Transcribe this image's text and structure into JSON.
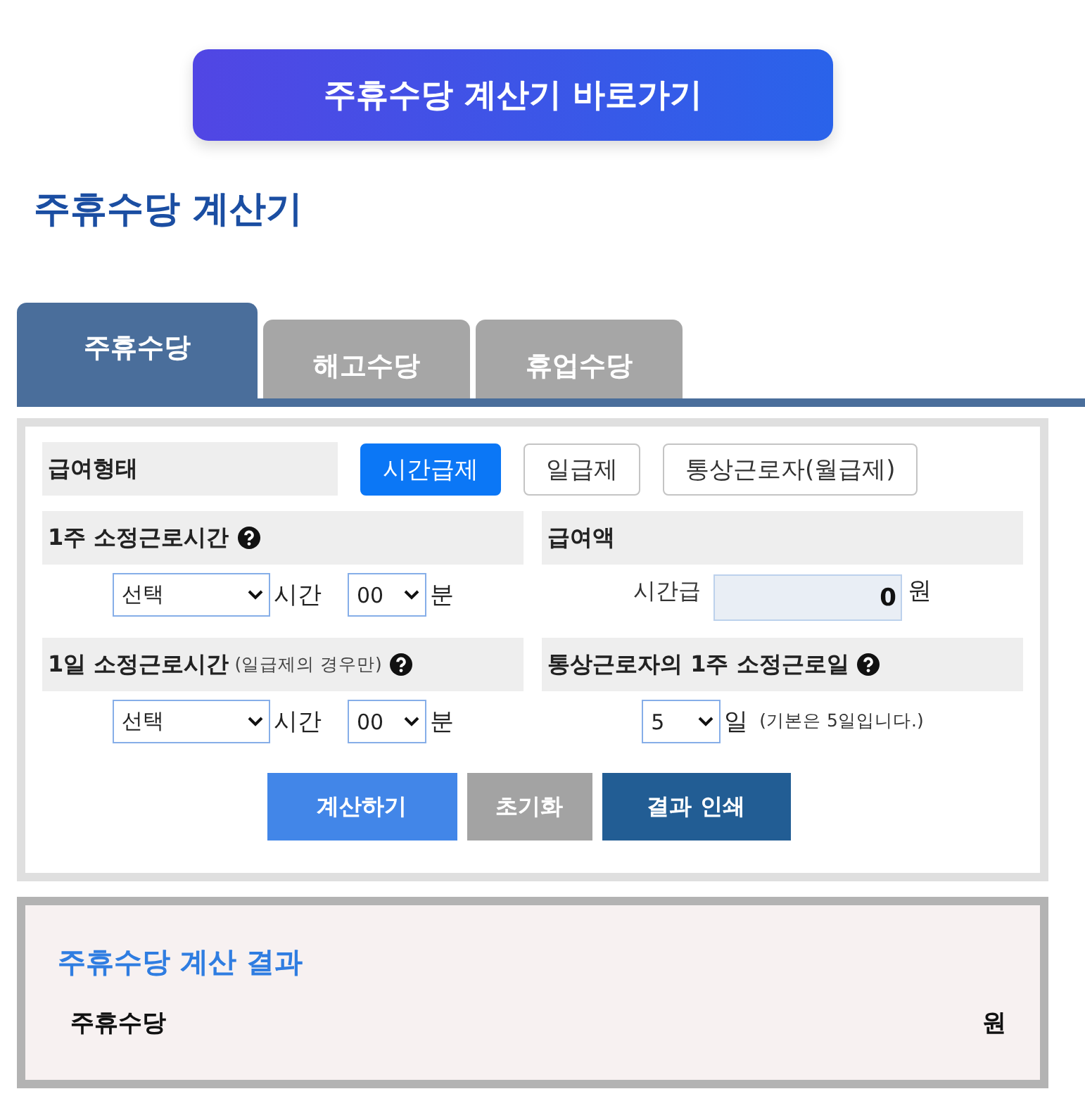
{
  "link_button": {
    "label": "주휴수당 계산기 바로가기"
  },
  "title": "주휴수당 계산기",
  "tabs": [
    {
      "label": "주휴수당",
      "selected": true
    },
    {
      "label": "해고수당",
      "selected": false
    },
    {
      "label": "휴업수당",
      "selected": false
    }
  ],
  "form": {
    "pay_type": {
      "label": "급여형태",
      "options": [
        {
          "label": "시간급제",
          "selected": true
        },
        {
          "label": "일급제",
          "selected": false
        },
        {
          "label": "통상근로자(월급제)",
          "selected": false
        }
      ]
    },
    "sections": [
      {
        "title": "1주 소정근로시간",
        "help": true,
        "controls": [
          {
            "kind": "dropdown",
            "value": "선택"
          },
          {
            "kind": "unit",
            "text": "시간"
          },
          {
            "kind": "select",
            "value": "00"
          },
          {
            "kind": "unit",
            "text": "분"
          }
        ]
      },
      {
        "title": "급여액",
        "help": false,
        "controls": [
          {
            "kind": "label",
            "text": "시간급"
          },
          {
            "kind": "input",
            "value": "0"
          },
          {
            "kind": "unit",
            "text": "원"
          }
        ]
      },
      {
        "title": "1일 소정근로시간",
        "note": "(일급제의 경우만)",
        "help": true,
        "controls": [
          {
            "kind": "dropdown",
            "value": "선택"
          },
          {
            "kind": "unit",
            "text": "시간"
          },
          {
            "kind": "select",
            "value": "00"
          },
          {
            "kind": "unit",
            "text": "분"
          }
        ]
      },
      {
        "title": "통상근로자의 1주 소정근로일",
        "help": true,
        "controls": [
          {
            "kind": "select",
            "value": "5"
          },
          {
            "kind": "unit",
            "text": "일"
          },
          {
            "kind": "note",
            "text": "(기본은 5일입니다.)"
          }
        ]
      }
    ],
    "buttons": [
      {
        "label": "계산하기",
        "kind": "primary"
      },
      {
        "label": "초기화",
        "kind": "reset"
      },
      {
        "label": "결과 인쇄",
        "kind": "print"
      }
    ]
  },
  "result": {
    "title": "주휴수당 계산 결과",
    "rows": [
      {
        "label": "주휴수당",
        "unit": "원"
      }
    ]
  }
}
